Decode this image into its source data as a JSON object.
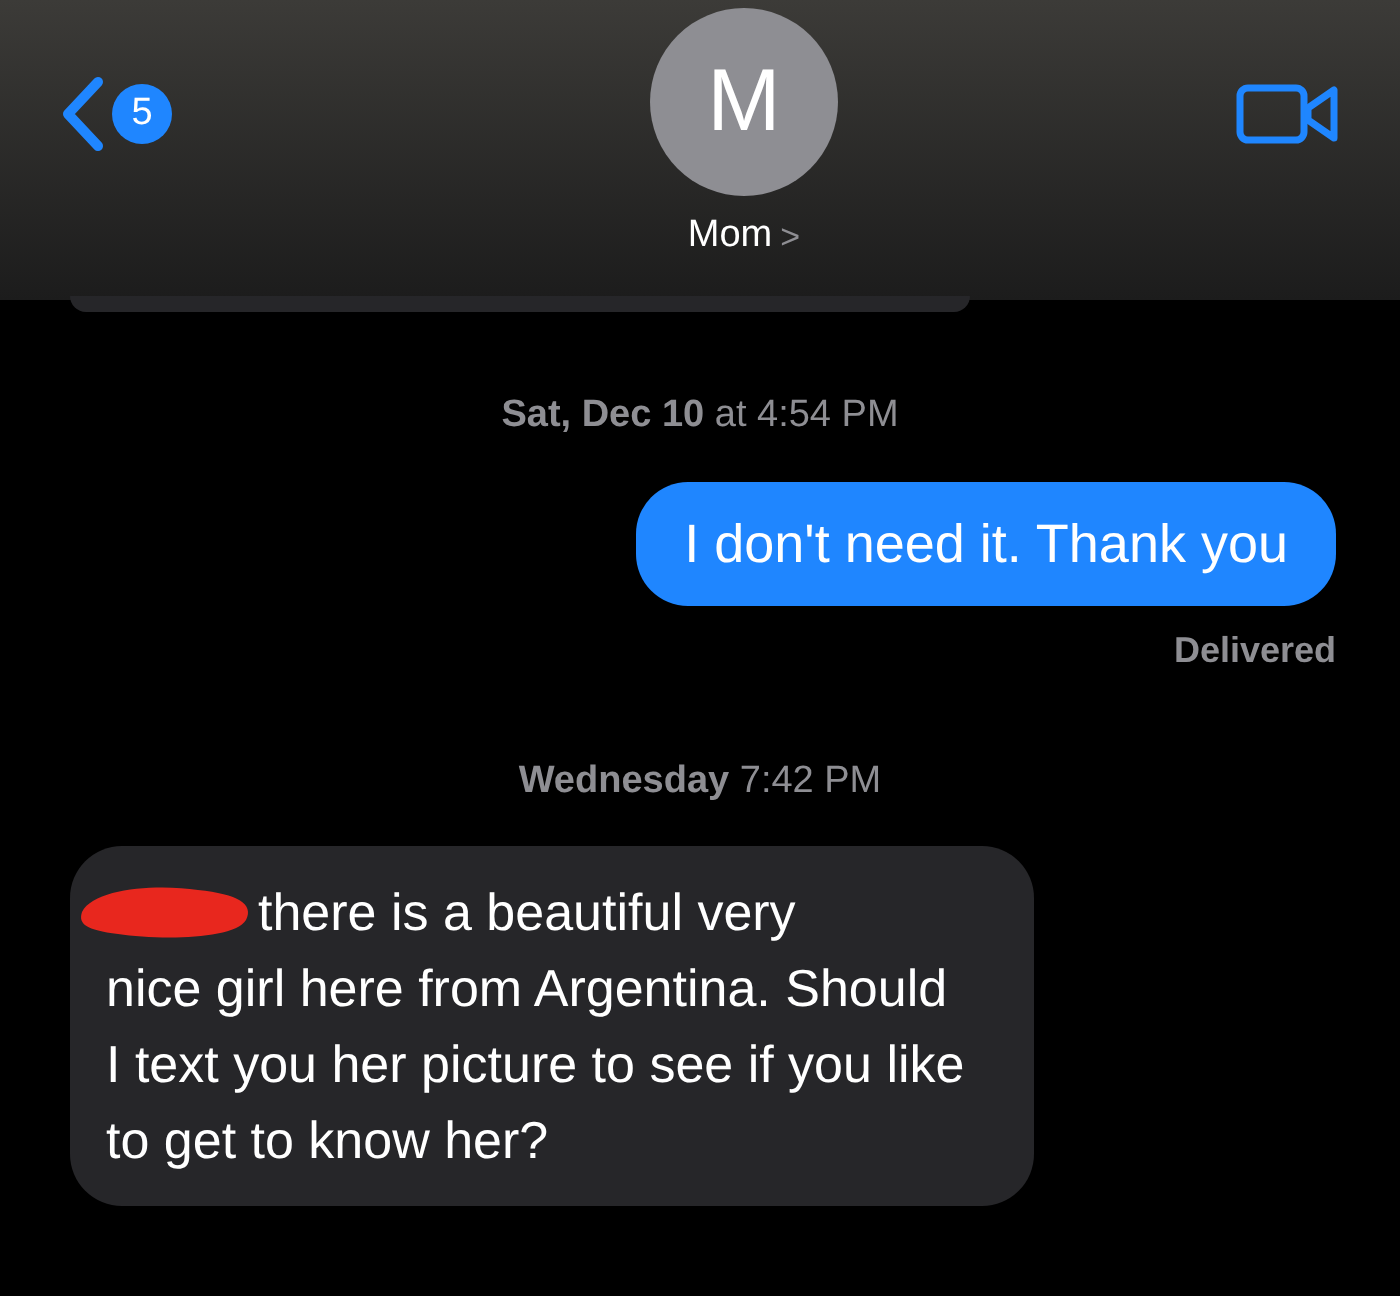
{
  "header": {
    "back_badge": "5",
    "avatar_initial": "M",
    "contact_name": "Mom",
    "chevron": ">"
  },
  "messages": [
    {
      "kind": "partial"
    },
    {
      "kind": "timestamp",
      "text": "**Sat, Dec 10** at 4:54 PM"
    },
    {
      "kind": "sent",
      "text": "I don't need it. Thank you"
    },
    {
      "kind": "status",
      "text": "Delivered"
    },
    {
      "kind": "timestamp",
      "text": "**Wednesday** 7:42 PM"
    },
    {
      "kind": "received",
      "redacted": true,
      "lead": "there is a beautiful very",
      "text": "nice girl here from Argentina. Should I text you her picture to see if you like to get to know her?"
    }
  ]
}
